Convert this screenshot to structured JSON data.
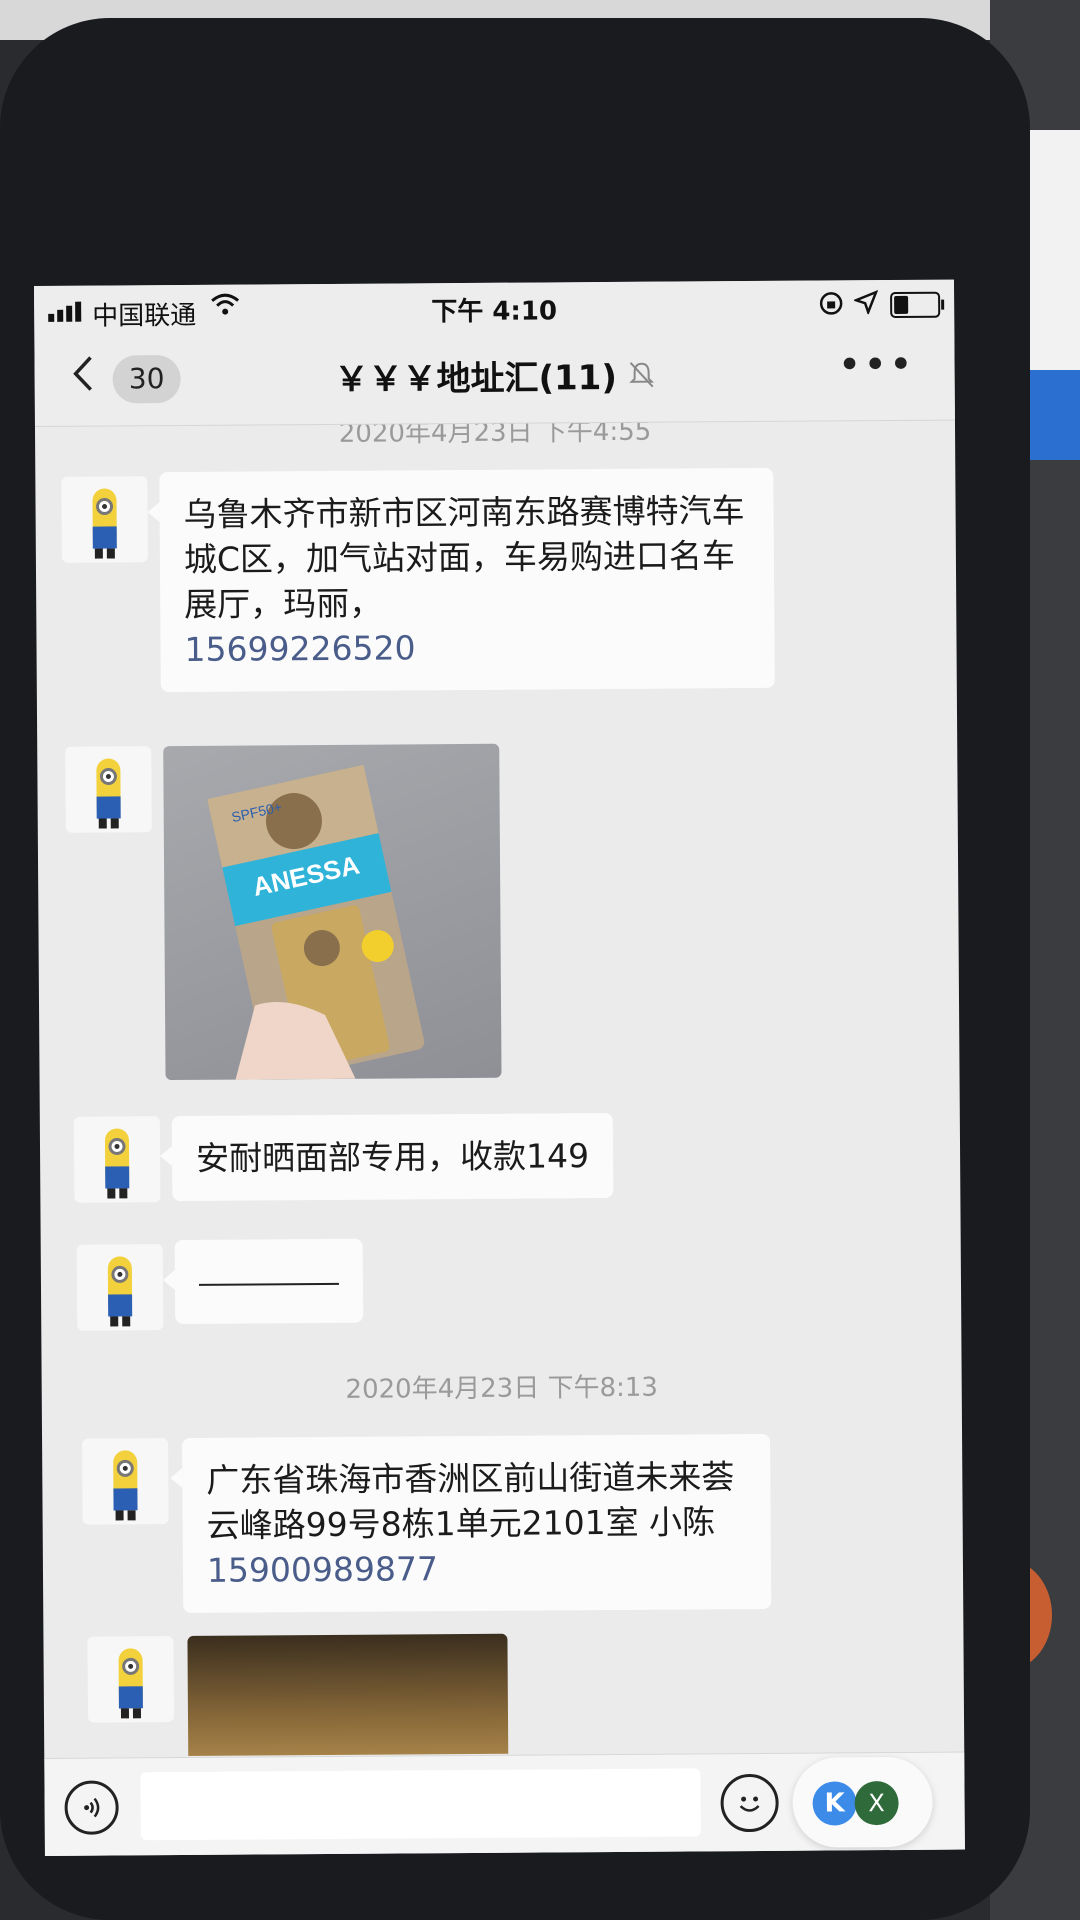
{
  "status_bar": {
    "carrier": "中国联通",
    "time": "下午 4:10",
    "battery_level": 0.35
  },
  "nav": {
    "unread_count": "30",
    "title": "￥￥￥地址汇(11)",
    "more": "•••"
  },
  "chat": {
    "timestamp_top": "2020年4月23日 下午4:55",
    "messages": [
      {
        "text": "乌鲁木齐市新市区河南东路赛博特汽车城C区，加气站对面，车易购进口名车展厅，玛丽，",
        "phone": "15699226520"
      },
      {
        "type": "image",
        "icon": "sunscreen-product-photo"
      },
      {
        "text": "安耐晒面部专用，收款149"
      },
      {
        "type": "dash"
      },
      {
        "type": "image",
        "icon": "partial-photo"
      }
    ],
    "timestamp_mid": "2020年4月23日 下午8:13",
    "address2": {
      "text": "广东省珠海市香洲区前山街道未来荟云峰路99号8栋1单元2101室 小陈",
      "phone": "15900989877"
    }
  },
  "input_bar": {
    "placeholder": "",
    "float_left": "K",
    "float_right": "X"
  },
  "photo": {
    "brand": "ANESSA",
    "spf": "SPF50+"
  }
}
